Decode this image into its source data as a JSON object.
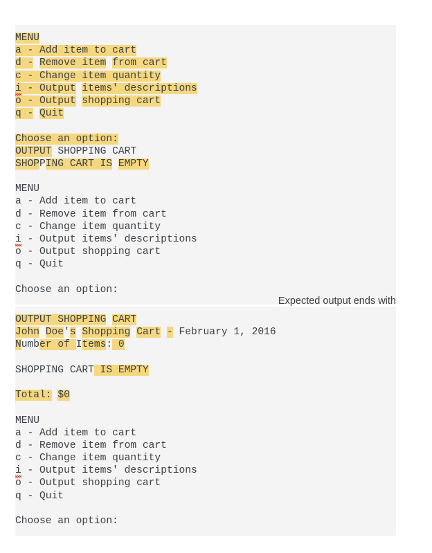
{
  "caption": {
    "text": "Expected output ends with"
  },
  "colors": {
    "panel_background": "#f4f4f4",
    "highlight": "#f5d77f",
    "text": "#3b4045",
    "spellcheck_underline": "#e03b24",
    "caption_text": "#3c4043",
    "page_background": "#ffffff"
  },
  "menu": {
    "title": "MENU",
    "options": [
      "a - Add item to cart",
      "d - Remove item from cart",
      "c - Change item quantity",
      "i - Output items' descriptions",
      "o - Output shopping cart",
      "q - Quit"
    ],
    "prompt": "Choose an option:"
  },
  "panel_1": {
    "lines": [
      {
        "id": "p1-l1",
        "text": "MENU",
        "segs": [
          [
            "MENU",
            true
          ]
        ]
      },
      {
        "id": "p1-l2",
        "text": "a - Add item to cart",
        "segs": [
          [
            "a - Add item to cart",
            true
          ]
        ]
      },
      {
        "id": "p1-l3",
        "text": "d - Remove item from cart",
        "segs": [
          [
            "d -",
            true
          ],
          [
            " ",
            false
          ],
          [
            "Remove item",
            true
          ],
          [
            " ",
            false
          ],
          [
            "from cart",
            true
          ]
        ]
      },
      {
        "id": "p1-l4",
        "text": "c - Change item quantity",
        "segs": [
          [
            "c - Change item quantity",
            true
          ]
        ]
      },
      {
        "id": "p1-l5",
        "text": "i - Output items' descriptions",
        "segs": [
          [
            "i",
            true,
            "spell"
          ],
          [
            " - Output",
            true
          ],
          [
            " ",
            false
          ],
          [
            "items' descriptions",
            true
          ]
        ]
      },
      {
        "id": "p1-l6",
        "text": "o - Output shopping cart",
        "segs": [
          [
            "o - Output",
            true
          ],
          [
            " ",
            false
          ],
          [
            "shopping cart",
            true
          ]
        ]
      },
      {
        "id": "p1-l7",
        "text": "q - Quit",
        "segs": [
          [
            "q -",
            true
          ],
          [
            " ",
            false
          ],
          [
            "Quit",
            true
          ]
        ]
      },
      {
        "id": "p1-l8",
        "text": "",
        "segs": []
      },
      {
        "id": "p1-l9",
        "text": "Choose an option:",
        "segs": [
          [
            "Choose an option:",
            true
          ]
        ]
      },
      {
        "id": "p1-l10",
        "text": "OUTPUT SHOPPING CART",
        "segs": [
          [
            "OUTPUT",
            true
          ],
          [
            " ",
            false
          ],
          [
            "SHOPPING CART",
            false
          ]
        ]
      },
      {
        "id": "p1-l11",
        "text": "SHOPPING CART IS EMPTY",
        "segs": [
          [
            "SHOP",
            true
          ],
          [
            "P",
            false
          ],
          [
            "ING CART IS",
            true
          ],
          [
            " ",
            false
          ],
          [
            "EMPTY",
            true
          ]
        ]
      },
      {
        "id": "p1-l12",
        "text": "",
        "segs": []
      },
      {
        "id": "p1-l13",
        "text": "MENU",
        "segs": [
          [
            "MENU",
            false
          ]
        ]
      },
      {
        "id": "p1-l14",
        "text": "a - Add item to cart",
        "segs": [
          [
            "a - Add item to cart",
            false
          ]
        ]
      },
      {
        "id": "p1-l15",
        "text": "d - Remove item from cart",
        "segs": [
          [
            "d - Remove item from cart",
            false
          ]
        ]
      },
      {
        "id": "p1-l16",
        "text": "c - Change item quantity",
        "segs": [
          [
            "c - Change item quantity",
            false
          ]
        ]
      },
      {
        "id": "p1-l17",
        "text": "i - Output items' descriptions",
        "segs": [
          [
            "i",
            false,
            "spell"
          ],
          [
            " - Output items' descriptions",
            false
          ]
        ]
      },
      {
        "id": "p1-l18",
        "text": "o - Output shopping cart",
        "segs": [
          [
            "o - Output shopping cart",
            false
          ]
        ]
      },
      {
        "id": "p1-l19",
        "text": "q - Quit",
        "segs": [
          [
            "q - Quit",
            false
          ]
        ]
      },
      {
        "id": "p1-l20",
        "text": "",
        "segs": []
      },
      {
        "id": "p1-l21",
        "text": "Choose an option:",
        "segs": [
          [
            "Choose an option:",
            false
          ]
        ]
      }
    ]
  },
  "panel_2": {
    "lines": [
      {
        "id": "p2-l1",
        "text": "OUTPUT SHOPPING CART",
        "segs": [
          [
            "OUTPUT SHOPPING",
            true
          ],
          [
            " ",
            false
          ],
          [
            "CART",
            true
          ]
        ]
      },
      {
        "id": "p2-l2",
        "text": "John Doe's Shopping Cart - February 1, 2016",
        "segs": [
          [
            "John",
            true
          ],
          [
            " ",
            false
          ],
          [
            "Doe",
            true
          ],
          [
            "'",
            false
          ],
          [
            "s",
            true
          ],
          [
            " ",
            false
          ],
          [
            "Shopping",
            true
          ],
          [
            " ",
            false
          ],
          [
            "Cart",
            true
          ],
          [
            " ",
            false
          ],
          [
            "-",
            true
          ],
          [
            " February 1, 2016",
            false
          ]
        ]
      },
      {
        "id": "p2-l3",
        "text": "Number of Items: 0",
        "segs": [
          [
            "N",
            true
          ],
          [
            "umb",
            false
          ],
          [
            "er of ",
            true
          ],
          [
            "I",
            false
          ],
          [
            "tems",
            true
          ],
          [
            ":",
            false
          ],
          [
            " ",
            true
          ],
          [
            "0",
            true
          ]
        ]
      },
      {
        "id": "p2-l4",
        "text": "",
        "segs": []
      },
      {
        "id": "p2-l5",
        "text": "SHOPPING CART IS EMPTY",
        "segs": [
          [
            "SHOPPING CART",
            false
          ],
          [
            " IS ",
            true
          ],
          [
            "EMP",
            true
          ],
          [
            "TY",
            true
          ]
        ]
      },
      {
        "id": "p2-l6",
        "text": "",
        "segs": []
      },
      {
        "id": "p2-l7",
        "text": "Total: $0",
        "segs": [
          [
            "Total:",
            true
          ],
          [
            " ",
            false
          ],
          [
            "$0",
            true
          ]
        ]
      },
      {
        "id": "p2-l8",
        "text": "",
        "segs": []
      },
      {
        "id": "p2-l9",
        "text": "MENU",
        "segs": [
          [
            "MENU",
            false
          ]
        ]
      },
      {
        "id": "p2-l10",
        "text": "a - Add item to cart",
        "segs": [
          [
            "a - Add item to cart",
            false
          ]
        ]
      },
      {
        "id": "p2-l11",
        "text": "d - Remove item from cart",
        "segs": [
          [
            "d - Remove item from cart",
            false
          ]
        ]
      },
      {
        "id": "p2-l12",
        "text": "c - Change item quantity",
        "segs": [
          [
            "c - Change item quantity",
            false
          ]
        ]
      },
      {
        "id": "p2-l13",
        "text": "i - Output items' descriptions",
        "segs": [
          [
            "i",
            false,
            "spell"
          ],
          [
            " - Output items' descriptions",
            false
          ]
        ]
      },
      {
        "id": "p2-l14",
        "text": "o - Output shopping cart",
        "segs": [
          [
            "o - Output shopping cart",
            false
          ]
        ]
      },
      {
        "id": "p2-l15",
        "text": "q - Quit",
        "segs": [
          [
            "q - Quit",
            false
          ]
        ]
      },
      {
        "id": "p2-l16",
        "text": "",
        "segs": []
      },
      {
        "id": "p2-l17",
        "text": "Choose an option:",
        "segs": [
          [
            "Choose an option:",
            false
          ]
        ]
      }
    ]
  }
}
